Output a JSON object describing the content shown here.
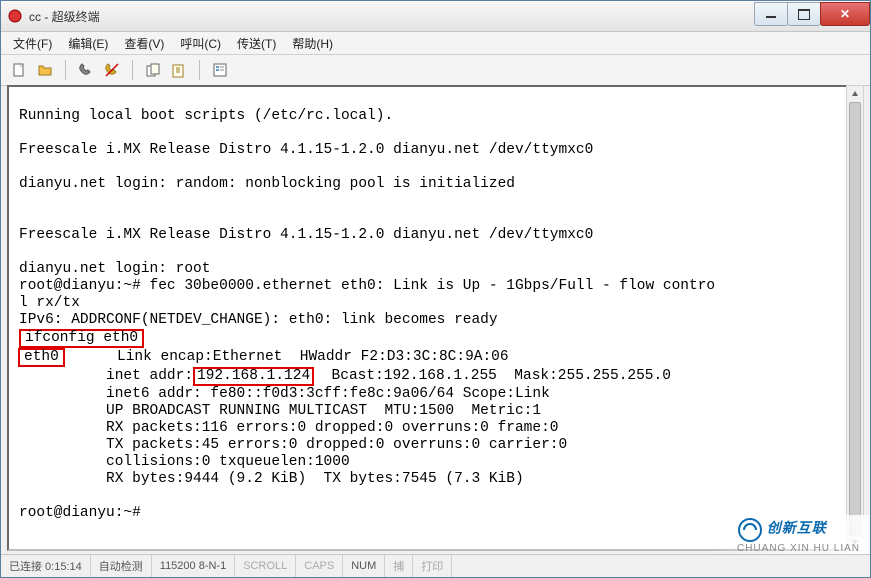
{
  "window": {
    "title": "cc - 超级终端"
  },
  "menu": {
    "file": "文件(F)",
    "edit": "编辑(E)",
    "view": "查看(V)",
    "call": "呼叫(C)",
    "transfer": "传送(T)",
    "help": "帮助(H)"
  },
  "toolbar_icons": {
    "new": "new-file-icon",
    "open": "open-folder-icon",
    "link": "phone-link-icon",
    "disconnect": "phone-disconnect-icon",
    "send": "send-icon",
    "receive": "receive-icon",
    "properties": "properties-icon"
  },
  "terminal": {
    "l01": "Running local boot scripts (/etc/rc.local).",
    "l02": "",
    "l03": "Freescale i.MX Release Distro 4.1.15-1.2.0 dianyu.net /dev/ttymxc0",
    "l04": "",
    "l05": "dianyu.net login: random: nonblocking pool is initialized",
    "l06": "",
    "l07": "",
    "l08": "Freescale i.MX Release Distro 4.1.15-1.2.0 dianyu.net /dev/ttymxc0",
    "l09": "",
    "l10": "dianyu.net login: root",
    "l11": "root@dianyu:~# fec 30be0000.ethernet eth0: Link is Up - 1Gbps/Full - flow contro",
    "l12": "l rx/tx",
    "l13_pre": "IPv6: ADDRCONF(NETDEV_CHANGE): eth0: link becomes ready",
    "l14_cmd": "ifconfig eth0",
    "l15_if": "eth0",
    "l15_mid": "      Link encap:Ethernet  HWaddr F2:D3:3C:8C:9A:06",
    "l16_pre": "          inet addr:",
    "l16_ip": "192.168.1.124",
    "l16_post": "  Bcast:192.168.1.255  Mask:255.255.255.0",
    "l17": "          inet6 addr: fe80::f0d3:3cff:fe8c:9a06/64 Scope:Link",
    "l18": "          UP BROADCAST RUNNING MULTICAST  MTU:1500  Metric:1",
    "l19": "          RX packets:116 errors:0 dropped:0 overruns:0 frame:0",
    "l20": "          TX packets:45 errors:0 dropped:0 overruns:0 carrier:0",
    "l21": "          collisions:0 txqueuelen:1000",
    "l22": "          RX bytes:9444 (9.2 KiB)  TX bytes:7545 (7.3 KiB)",
    "l23": "",
    "l24": "root@dianyu:~#"
  },
  "status": {
    "connected": "已连接 0:15:14",
    "detect": "自动检测",
    "serial": "115200 8-N-1",
    "scroll": "SCROLL",
    "caps": "CAPS",
    "num": "NUM",
    "capture": "捕",
    "print": "打印"
  },
  "watermark": {
    "brand": "创新互联",
    "sub": "CHUANG XIN HU LIAN"
  }
}
